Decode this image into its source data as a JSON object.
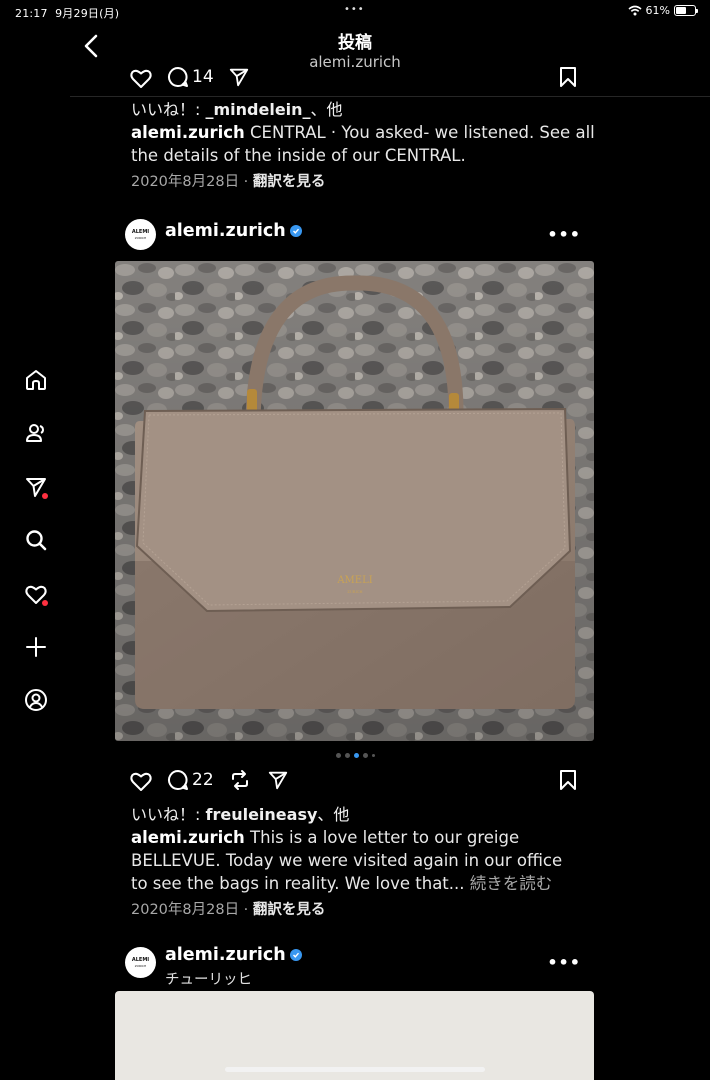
{
  "status_bar": {
    "time": "21:17",
    "date": "9月29日(月)",
    "dots": "•••",
    "battery_pct": "61%",
    "battery_level": 0.61
  },
  "header": {
    "title": "投稿",
    "subtitle": "alemi.zurich"
  },
  "nav": [
    "home-icon",
    "people-icon",
    "send-icon",
    "search-icon",
    "heart-icon",
    "plus-icon",
    "profile-icon"
  ],
  "post1": {
    "comment_count": "14",
    "likes_prefix": "いいね！: ",
    "likes_user": "_mindelein_",
    "likes_suffix": "、他",
    "caption_user": "alemi.zurich",
    "caption_text": " CENTRAL · You asked- we listened. See all the details of the inside of our CENTRAL.",
    "date": "2020年8月28日",
    "separator": " · ",
    "translate": "翻訳を見る"
  },
  "post2": {
    "avatar_text": "ALEMI",
    "avatar_sub": "ZURICH",
    "username": "alemi.zurich",
    "more": "•••",
    "bag_brand": "AMELI",
    "bag_brand_sub": "ZURICH",
    "comment_count": "22",
    "likes_prefix": "いいね！: ",
    "likes_user": "freuleineasy",
    "likes_suffix": "、他",
    "caption_user": "alemi.zurich",
    "caption_text": " This is a love letter to our greige BELLEVUE. Today we were visited again in our office to see the bags in reality. We love that...",
    "read_more": " 続きを読む",
    "date": "2020年8月28日",
    "separator": " · ",
    "translate": "翻訳を見る"
  },
  "post3": {
    "avatar_text": "ALEMI",
    "avatar_sub": "ZURICH",
    "username": "alemi.zurich",
    "location": "チューリッヒ",
    "more": "•••"
  },
  "colors": {
    "background": "#000000",
    "verified": "#3897f0",
    "notification": "#ff3040"
  }
}
